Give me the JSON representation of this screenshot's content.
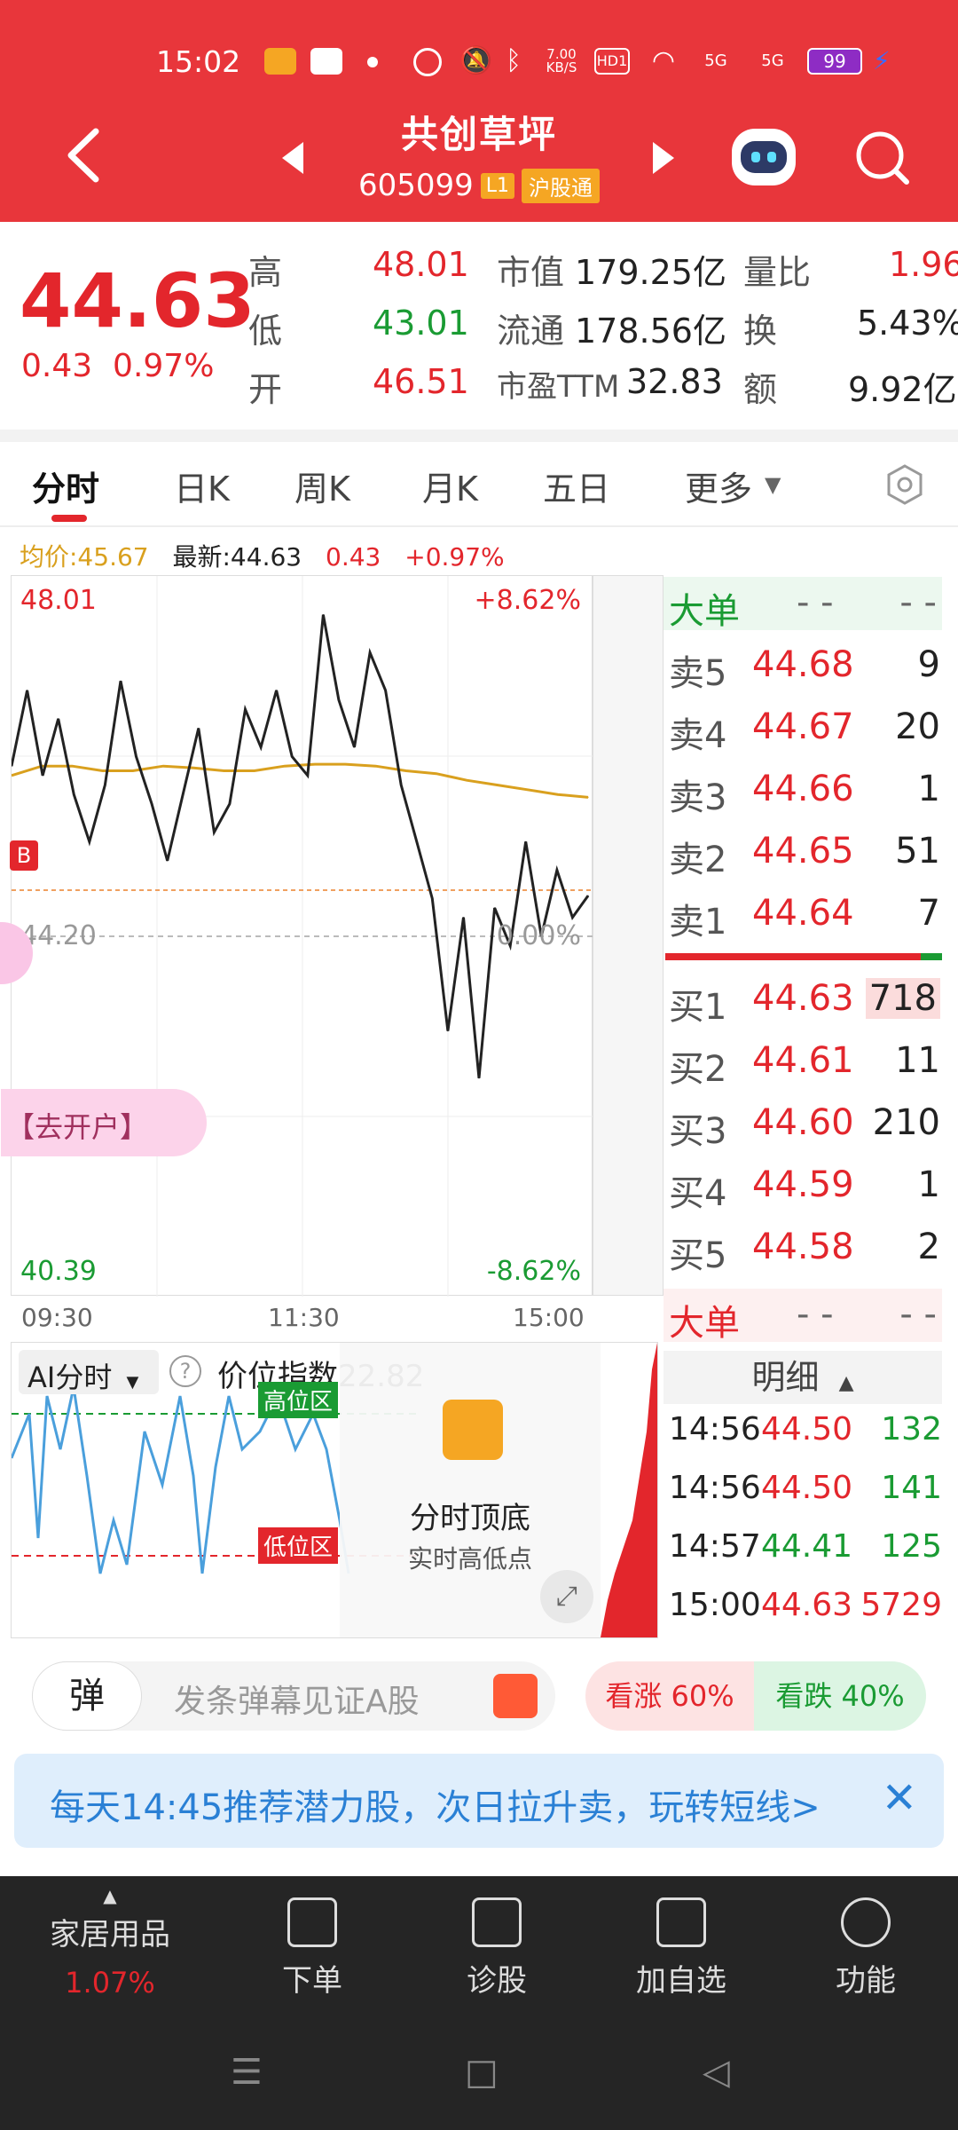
{
  "status_bar": {
    "time": "15:02",
    "network_speed": "7.00 KB/S",
    "hd": "HD1",
    "signal1": "5G",
    "signal2": "5G",
    "battery": "99"
  },
  "header": {
    "stock_name": "共创草坪",
    "stock_code": "605099",
    "level_tag": "L1",
    "market_tag": "沪股通"
  },
  "quote": {
    "price": "44.63",
    "change": "0.43",
    "change_pct": "0.97%",
    "high_label": "高",
    "high": "48.01",
    "low_label": "低",
    "low": "43.01",
    "open_label": "开",
    "open": "46.51",
    "mkt_cap_label": "市值",
    "mkt_cap": "179.25亿",
    "float_label": "流通",
    "float": "178.56亿",
    "pe_label": "市盈TTM",
    "pe": "32.83",
    "vol_ratio_label": "量比",
    "vol_ratio": "1.96",
    "turnover_label": "换",
    "turnover": "5.43%",
    "amount_label": "额",
    "amount": "9.92亿"
  },
  "tabs": {
    "t1": "分时",
    "t2": "日K",
    "t3": "周K",
    "t4": "月K",
    "t5": "五日",
    "t6": "更多"
  },
  "legend": {
    "avg": "均价:45.67",
    "latest": "最新:44.63",
    "chg": "0.43",
    "pct": "+0.97%"
  },
  "chart": {
    "y_top": "48.01",
    "y_bottom": "40.39",
    "pct_top": "+8.62%",
    "pct_bottom": "-8.62%",
    "mid_price": "44.20",
    "mid_pct": "0.00%",
    "t_start": "09:30",
    "t_mid": "11:30",
    "t_end": "15:00",
    "buy_marker": "B",
    "open_account": "【去开户】"
  },
  "chart_data": {
    "type": "line",
    "title": "",
    "xlabel": "",
    "ylabel": "",
    "x_ticks": [
      "09:30",
      "11:30",
      "15:00"
    ],
    "ylim": [
      40.39,
      48.01
    ],
    "series": [
      {
        "name": "",
        "values": [
          46.0,
          46.8,
          45.9,
          46.5,
          45.7,
          45.2,
          45.8,
          46.9,
          46.1,
          45.6,
          45.0,
          45.7,
          46.4,
          45.3,
          45.6,
          46.6,
          46.2,
          46.8,
          46.1,
          45.9,
          47.6,
          46.7,
          46.2,
          47.2,
          46.8,
          45.8,
          45.2,
          44.6,
          43.2,
          44.4,
          42.7,
          44.5,
          44.1,
          45.2,
          44.2,
          44.9,
          44.4,
          44.63
        ]
      },
      {
        "name": "均价",
        "values": [
          45.9,
          46.0,
          46.0,
          45.95,
          45.95,
          46.0,
          45.98,
          45.95,
          45.95,
          46.0,
          46.02,
          46.02,
          46.0,
          45.95,
          45.92,
          45.85,
          45.8,
          45.75,
          45.7,
          45.67
        ]
      }
    ]
  },
  "order_book": {
    "big_label": "大单",
    "big_v1": "- -",
    "big_v2": "- -",
    "asks": [
      {
        "label": "卖5",
        "price": "44.68",
        "vol": "9"
      },
      {
        "label": "卖4",
        "price": "44.67",
        "vol": "20"
      },
      {
        "label": "卖3",
        "price": "44.66",
        "vol": "1"
      },
      {
        "label": "卖2",
        "price": "44.65",
        "vol": "51"
      },
      {
        "label": "卖1",
        "price": "44.64",
        "vol": "7"
      }
    ],
    "bids": [
      {
        "label": "买1",
        "price": "44.63",
        "vol": "718"
      },
      {
        "label": "买2",
        "price": "44.61",
        "vol": "11"
      },
      {
        "label": "买3",
        "price": "44.60",
        "vol": "210"
      },
      {
        "label": "买4",
        "price": "44.59",
        "vol": "1"
      },
      {
        "label": "买5",
        "price": "44.58",
        "vol": "2"
      }
    ],
    "detail_label": "明细",
    "ticks": [
      {
        "time": "14:56",
        "price": "44.50",
        "vol": "132"
      },
      {
        "time": "14:56",
        "price": "44.50",
        "vol": "141"
      },
      {
        "time": "14:57",
        "price": "44.41",
        "vol": "125"
      },
      {
        "time": "15:00",
        "price": "44.63",
        "vol": "5729"
      }
    ]
  },
  "ai_panel": {
    "dropdown": "AI分时",
    "index_label": "价位指数22.82",
    "high_zone": "高位区",
    "low_zone": "低位区",
    "popup_title": "分时顶底",
    "popup_sub": "实时高低点"
  },
  "danmu": {
    "button": "弹",
    "placeholder": "发条弹幕见证A股",
    "vote_up": "看涨 60%",
    "vote_down": "看跌 40%"
  },
  "promo": {
    "text": "每天14:45推荐潜力股，次日拉升卖，玩转短线>"
  },
  "bottom_nav": {
    "sector": "家居用品",
    "sector_pct": "1.07%",
    "order": "下单",
    "diagnose": "诊股",
    "add_watch": "加自选",
    "functions": "功能"
  },
  "colors": {
    "header_red": "#e8363b",
    "up_red": "#e3262c",
    "down_green": "#1a9b33",
    "avg_line": "#d9a01e",
    "price_line": "#222222"
  }
}
